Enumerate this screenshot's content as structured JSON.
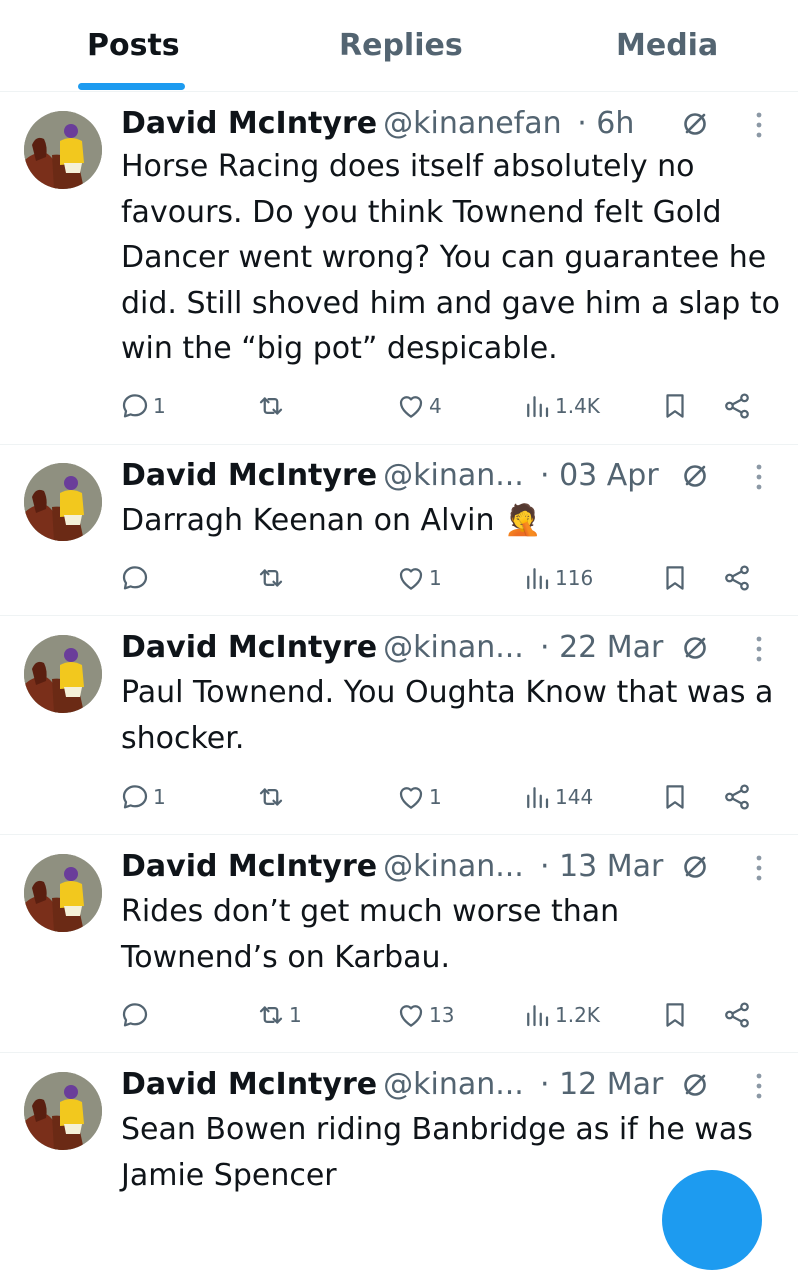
{
  "tabs": [
    {
      "label": "Posts",
      "active": true
    },
    {
      "label": "Replies",
      "active": false
    },
    {
      "label": "Media",
      "active": false
    }
  ],
  "posts": [
    {
      "name": "David McIntyre",
      "handle": "@kinanefan",
      "date": "· 6h",
      "text": "Horse Racing does itself absolutely no favours. Do you think Townend felt Gold Dancer went wrong? You can guarantee he did. Still shoved him and gave him a slap to win the “big pot” despicable.",
      "replies": "1",
      "reposts": "",
      "likes": "4",
      "views": "1.4K"
    },
    {
      "name": "David McIntyre",
      "handle": "@kinan...",
      "date": "· 03 Apr",
      "text": "Darragh Keenan on Alvin 🤦",
      "replies": "",
      "reposts": "",
      "likes": "1",
      "views": "116"
    },
    {
      "name": "David McIntyre",
      "handle": "@kinan...",
      "date": "· 22 Mar",
      "text": "Paul Townend. You Oughta Know that was a shocker.",
      "replies": "1",
      "reposts": "",
      "likes": "1",
      "views": "144"
    },
    {
      "name": "David McIntyre",
      "handle": "@kinan...",
      "date": "· 13 Mar",
      "text": "Rides don’t get much worse than Townend’s on Karbau.",
      "replies": "",
      "reposts": "1",
      "likes": "13",
      "views": "1.2K"
    },
    {
      "name": "David McIntyre",
      "handle": "@kinan...",
      "date": "· 12 Mar",
      "text": "Sean Bowen riding Banbridge as if he was Jamie Spencer",
      "replies": "",
      "reposts": "",
      "likes": "",
      "views": ""
    }
  ],
  "icons": {
    "reply": "reply-icon",
    "repost": "repost-icon",
    "like": "heart-icon",
    "views": "views-icon",
    "bookmark": "bookmark-icon",
    "share": "share-icon",
    "verified": "verified-icon",
    "more": "more-dots-icon"
  },
  "colors": {
    "accent": "#1d9bf0",
    "text": "#0f1419",
    "muted": "#536471",
    "divider": "#eff3f4",
    "silk_yellow": "#f2c81e",
    "silk_purple": "#6a3d9a"
  }
}
